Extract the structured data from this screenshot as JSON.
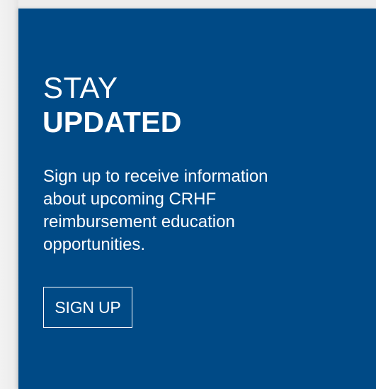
{
  "colors": {
    "card_background": "#004a86",
    "text": "#ffffff",
    "page_background": "#ececec"
  },
  "newsletter": {
    "heading_light": "STAY",
    "heading_bold": "UPDATED",
    "description_lines": [
      "Sign up to receive information",
      "about upcoming CRHF",
      "reimbursement education",
      "opportunities."
    ],
    "button_label": "SIGN UP"
  }
}
